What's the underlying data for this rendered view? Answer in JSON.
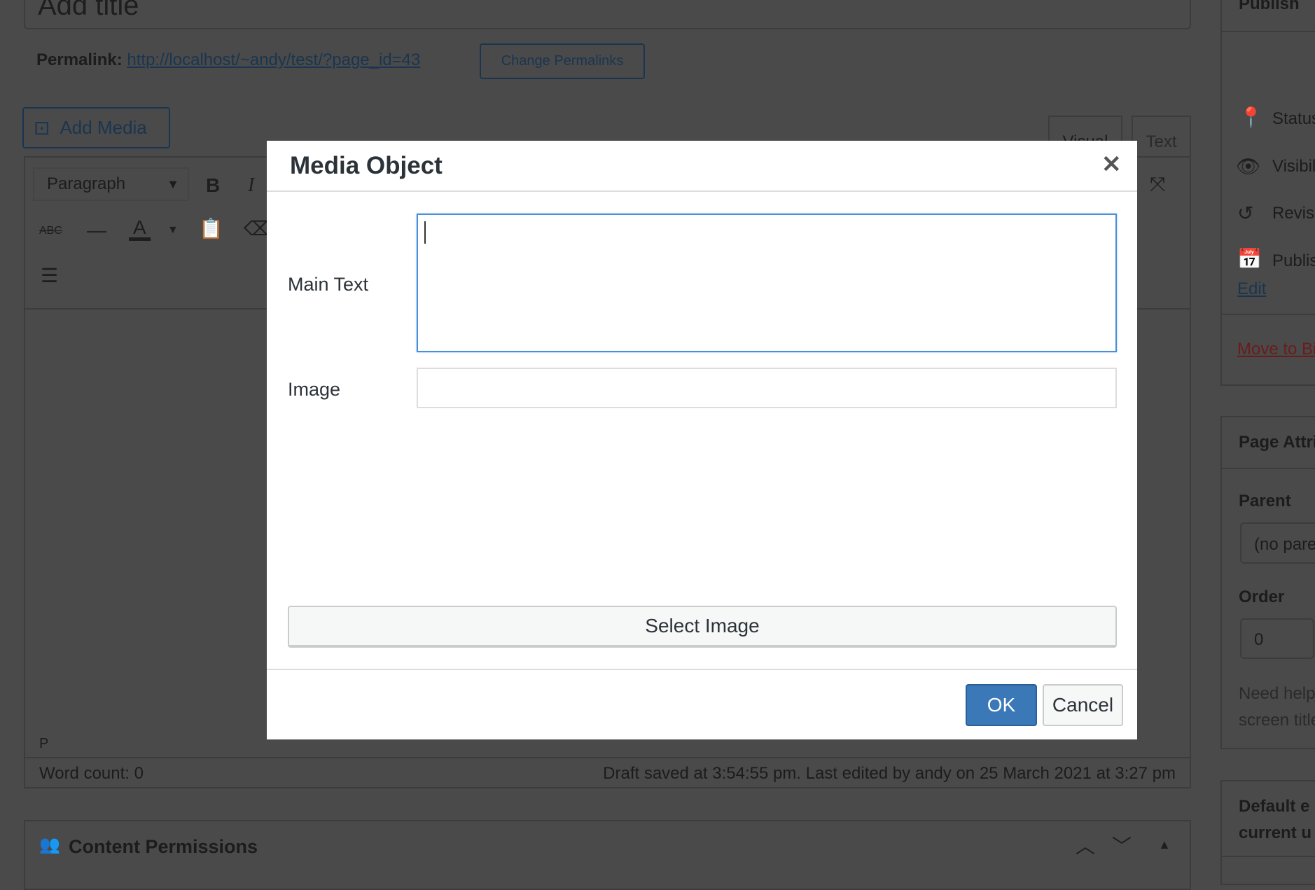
{
  "title_placeholder": "Add title",
  "permalink": {
    "label": "Permalink:",
    "url": "http://localhost/~andy/test/?page_id=43",
    "change_button": "Change Permalinks"
  },
  "add_media": "Add Media",
  "editor": {
    "tabs": [
      "Visual",
      "Text"
    ],
    "format_select": "Paragraph",
    "path": "P",
    "word_count": "Word count: 0",
    "save_status": "Draft saved at 3:54:55 pm. Last edited by andy on 25 March 2021 at 3:27 pm"
  },
  "content_permissions": "Content Permissions",
  "sidebar": {
    "publish": {
      "title": "Publish",
      "status": "Status",
      "visibility": "Visibility",
      "revisions": "Revisions",
      "publish": "Publish",
      "edit": "Edit",
      "trash": "Move to Bin"
    },
    "page_attributes": {
      "title": "Page Attributes",
      "parent_label": "Parent",
      "parent_value": "(no parent)",
      "order_label": "Order",
      "order_value": "0",
      "help": [
        "Need help?",
        "screen title"
      ]
    },
    "default": [
      "Default e",
      "current u"
    ]
  },
  "dialog": {
    "title": "Media Object",
    "main_text_label": "Main Text",
    "main_text_value": "",
    "image_label": "Image",
    "image_value": "",
    "select_image": "Select Image",
    "ok": "OK",
    "cancel": "Cancel",
    "accent": "#3a78b8"
  }
}
